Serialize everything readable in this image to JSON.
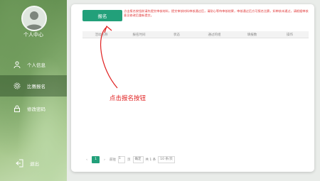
{
  "sidebar": {
    "user_center_label": "个人中心",
    "items": [
      {
        "label": "个人信息",
        "icon": "user-icon"
      },
      {
        "label": "比赛报名",
        "icon": "gear-icon",
        "active": true
      },
      {
        "label": "修改密码",
        "icon": "lock-icon"
      }
    ],
    "logout_label": "退出"
  },
  "main": {
    "signup_button_label": "报名",
    "note": "点击报名按钮前请先提交审核材料，提交审核材料审核通过后，请耐心等待审核结果，审核通过后方可报名比赛，如审核未通过，请根据审核意见修改后重新提交。",
    "table_headers": [
      "活动名称",
      "报名时间",
      "状态",
      "通过的组",
      "填报数",
      "操作"
    ],
    "annotation": "点击报名按钮",
    "pagination": {
      "current_page": "1",
      "goto_label": "前往",
      "goto_page": "1",
      "page_unit": "页",
      "confirm_label": "确定",
      "total_label": "共 1 条",
      "page_size_label": "10 条/页"
    }
  },
  "colors": {
    "accent": "#22a07a",
    "annotation": "#e02020"
  }
}
